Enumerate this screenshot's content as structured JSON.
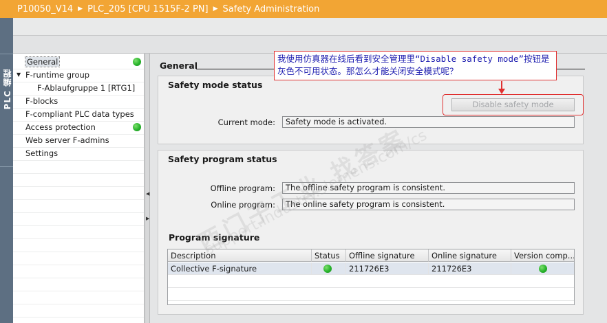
{
  "sidebar_label": "PLC 编程",
  "breadcrumb": [
    "P10050_V14",
    "PLC_205 [CPU 1515F-2 PN]",
    "Safety Administration"
  ],
  "nav": {
    "items": [
      {
        "label": "General",
        "indent": 0,
        "selected": true,
        "status": "green"
      },
      {
        "label": "F-runtime group",
        "indent": 0,
        "expanded": true
      },
      {
        "label": "F-Ablaufgruppe 1 [RTG1]",
        "indent": 1
      },
      {
        "label": "F-blocks",
        "indent": 0
      },
      {
        "label": "F-compliant PLC data types",
        "indent": 0
      },
      {
        "label": "Access protection",
        "indent": 0,
        "status": "green"
      },
      {
        "label": "Web server F-admins",
        "indent": 0
      },
      {
        "label": "Settings",
        "indent": 0
      }
    ]
  },
  "content": {
    "section_title": "General",
    "safety_mode": {
      "title": "Safety mode status",
      "disable_button_label": "Disable safety mode",
      "current_mode_label": "Current mode:",
      "current_mode_value": "Safety mode is activated."
    },
    "program_status": {
      "title": "Safety program status",
      "offline_label": "Offline program:",
      "offline_value": "The offline safety program is consistent.",
      "online_label": "Online program:",
      "online_value": "The online safety program is consistent."
    },
    "signature": {
      "title": "Program signature",
      "columns": [
        "Description",
        "Status",
        "Offline signature",
        "Online signature",
        "Version comp..."
      ],
      "rows": [
        {
          "description": "Collective F-signature",
          "status": "green",
          "offline": "211726E3",
          "online": "211726E3",
          "version": "green"
        }
      ]
    }
  },
  "callout": {
    "text": "我使用仿真器在线后看到安全管理里“Disable safety mode”按钮是灰色不可用状态。那怎么才能关闭安全模式呢？"
  },
  "watermark": {
    "line1": "西门子工业  找答案",
    "line2": "support.industry.siemens.com/cs"
  },
  "colors": {
    "title_bar": "#f2a534",
    "side_strip": "#5d6f82",
    "status_green": "#27b32b",
    "annotation_red": "#e03030",
    "callout_text": "#1d1db0"
  }
}
